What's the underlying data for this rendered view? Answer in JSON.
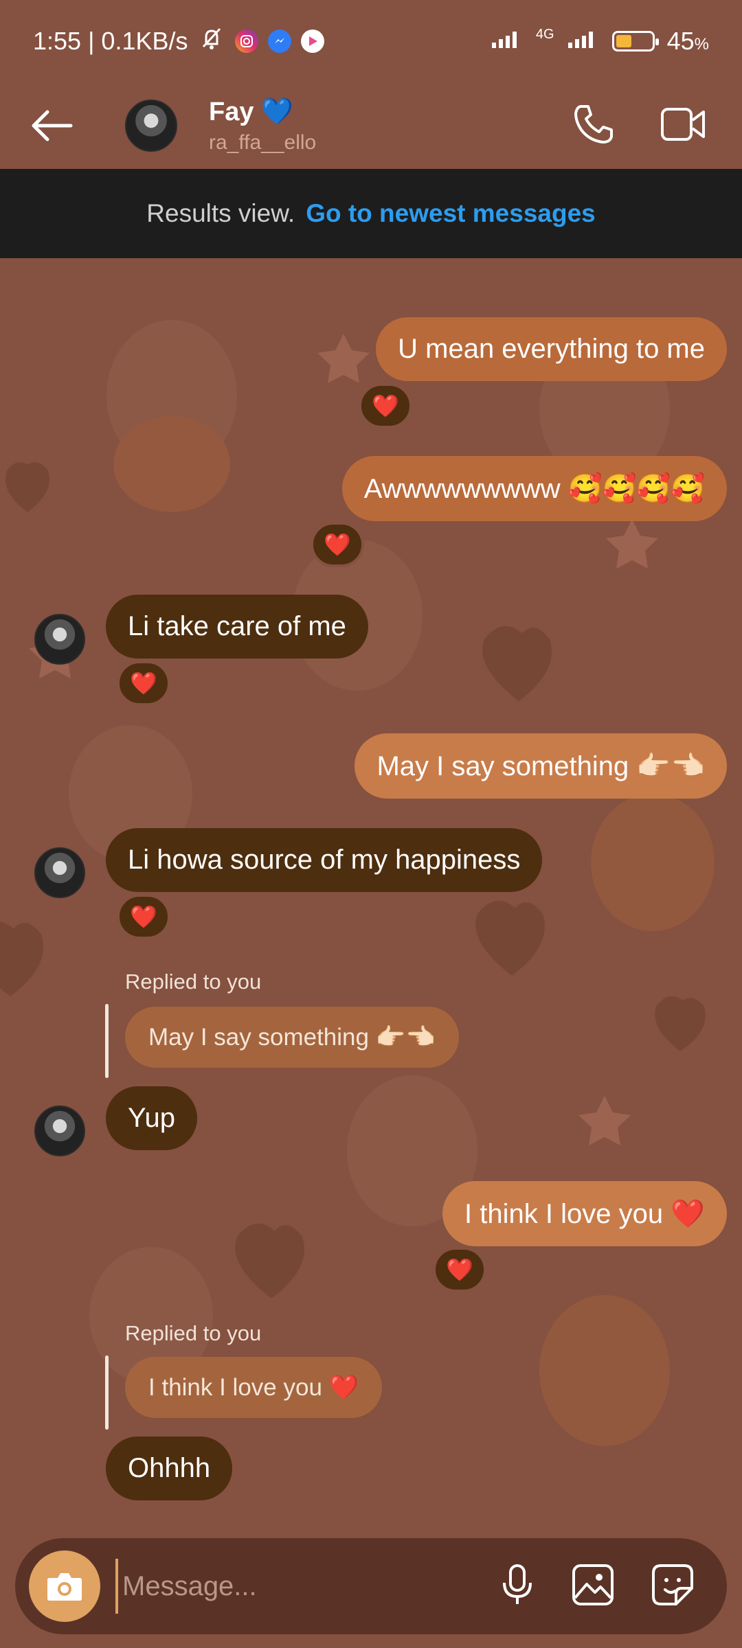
{
  "status_bar": {
    "time_net": "1:55 | 0.1KB/s",
    "network_type": "4G",
    "battery": "45",
    "battery_unit": "%",
    "battery_level": 0.45,
    "icons": [
      "mute-icon",
      "instagram-icon",
      "messenger-icon",
      "play-icon",
      "signal-icon",
      "battery-icon"
    ]
  },
  "header": {
    "name": "Fay",
    "name_badge": "💙",
    "username": "ra_ffa__ello",
    "icons": [
      "back-arrow-icon",
      "phone-icon",
      "video-icon"
    ]
  },
  "results": {
    "label": "Results view.",
    "link": "Go to newest messages"
  },
  "messages": [
    {
      "dir": "out",
      "text": "U mean everything to me",
      "reaction": "❤️"
    },
    {
      "dir": "out",
      "text": "Awwwwwwwww 🥰🥰🥰🥰",
      "reaction": "❤️"
    },
    {
      "dir": "in",
      "text": "Li take care of me",
      "reaction": "❤️"
    },
    {
      "dir": "out",
      "text": "May I say something 👉🏻👈🏻"
    },
    {
      "dir": "in",
      "text": "Li howa source of my happiness",
      "reaction": "❤️"
    },
    {
      "dir": "in",
      "reply_label": "Replied to you",
      "reply_text": "May I say something 👉🏻👈🏻",
      "text": "Yup"
    },
    {
      "dir": "out",
      "text": "I think I love you ❤️",
      "reaction": "❤️"
    },
    {
      "dir": "in",
      "reply_label": "Replied to you",
      "reply_text": "I think I love you ❤️",
      "text": "Ohhhh"
    }
  ],
  "composer": {
    "placeholder": "Message...",
    "icons": [
      "camera-icon",
      "microphone-icon",
      "gallery-icon",
      "sticker-icon"
    ]
  },
  "colors": {
    "background": "#855140",
    "outgoing_bubble": "#b96a3a",
    "incoming_bubble": "#4d2e0f",
    "link": "#2c9df0",
    "results_bar": "#1d1d1d"
  }
}
